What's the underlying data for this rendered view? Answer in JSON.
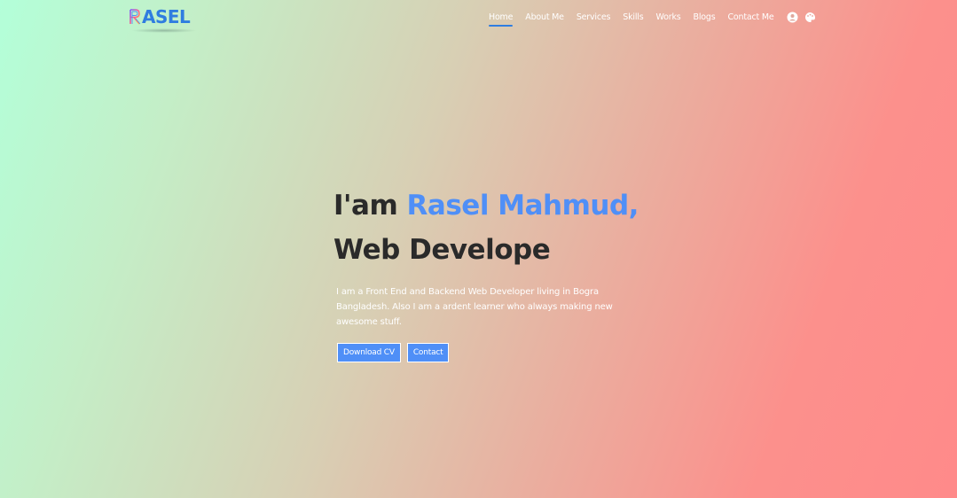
{
  "brand": {
    "logo_text": "ASEL",
    "logo_letter": "R"
  },
  "nav": {
    "links": [
      {
        "label": "Home",
        "active": true
      },
      {
        "label": "About Me"
      },
      {
        "label": "Services"
      },
      {
        "label": "Skills"
      },
      {
        "label": "Works"
      },
      {
        "label": "Blogs"
      },
      {
        "label": "Contact Me"
      }
    ],
    "icons": [
      "user-circle-icon",
      "palette-icon"
    ]
  },
  "hero": {
    "greeting": "I'am ",
    "name": "Rasel Mahmud,",
    "role": "Web Develope",
    "description": "I am a Front End and Backend Web Developer living in Bogra Bangladesh. Also I am a ardent learner who always making new awesome stuff.",
    "buttons": {
      "download": "Download CV",
      "contact": "Contact"
    }
  },
  "colors": {
    "accent": "#4f8ff7",
    "logo": "#2f7de0",
    "heading": "#2a2a2a",
    "gradient_start": "#b3ffd9",
    "gradient_end": "#ff8a8a"
  }
}
